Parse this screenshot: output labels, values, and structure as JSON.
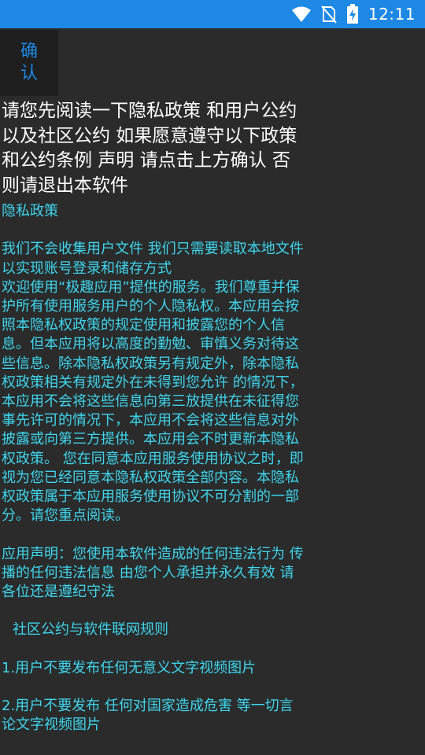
{
  "status_bar": {
    "time": "12:11",
    "icons": [
      "wifi-icon",
      "no-sim-icon",
      "battery-charging-icon"
    ],
    "color": "#1e88e5"
  },
  "confirm_button": {
    "label": "确认"
  },
  "intro_text": "请您先阅读一下隐私政策 和用户公约 以及社区公约 如果愿意遵守以下政策和公约条例 声明 请点击上方确认 否则请退出本软件",
  "policy": {
    "title": "隐私政策",
    "paragraph1": "我们不会收集用户文件 我们只需要读取本地文件 以实现账号登录和储存方式",
    "paragraph2": "欢迎使用“极趣应用”提供的服务。我们尊重并保护所有使用服务用户的个人隐私权。本应用会按照本隐私权政策的规定使用和披露您的个人信息。但本应用将以高度的勤勉、审慎义务对待这些信息。除本隐私权政策另有规定外，除本隐私权政策相关有规定外在未得到您允许 的情况下，本应用不会将这些信息向第三放提供在未征得您事先许可的情况下，本应用不会将这些信息对外披露或向第三方提供。本应用会不时更新本隐私权政策。 您在同意本应用服务使用协议之时，即视为您已经同意本隐私权政策全部内容。本隐私权政策属于本应用服务使用协议不可分割的一部分。请您重点阅读。",
    "statement": "应用声明：您使用本软件造成的任何违法行为 传播的任何违法信息 由您个人承担并永久有效 请各位还是遵纪守法",
    "community_title": "社区公约与软件联网规则",
    "rule1": "1.用户不要发布任何无意义文字视频图片",
    "rule2": "2.用户不要发布 任何对国家造成危害 等一切言论文字视频图片"
  },
  "colors": {
    "background": "#2b2b2b",
    "accent": "#1e88e5",
    "policy_text": "#3ed6ec",
    "intro_text": "#ffffff"
  }
}
